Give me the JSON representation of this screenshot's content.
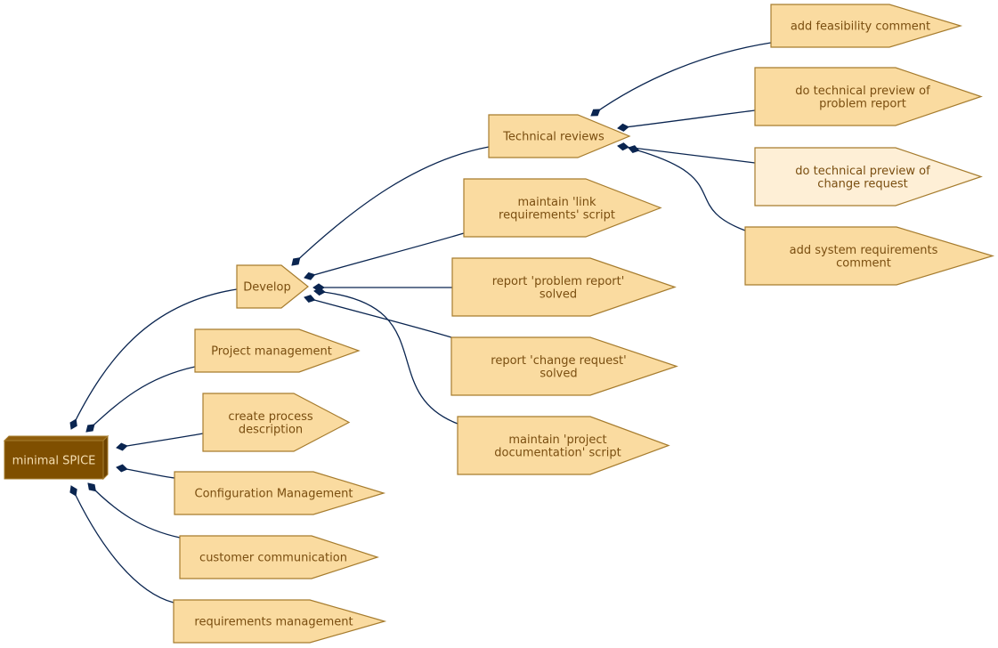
{
  "diagram": {
    "title": "minimal SPICE",
    "colors": {
      "edge": "#0a2550",
      "node_fill": "#fadba0",
      "node_fill_light": "#feefd6",
      "node_border": "#a67c2e",
      "node_text": "#7a4e10",
      "root_fill": "#7f4f00",
      "root_text": "#f5deb0"
    },
    "root": {
      "id": "root",
      "label": "minimal SPICE"
    },
    "nodes": [
      {
        "id": "develop",
        "lines": [
          "Develop"
        ],
        "parent": "root"
      },
      {
        "id": "project-management",
        "lines": [
          "Project management"
        ],
        "parent": "root"
      },
      {
        "id": "create-process-description",
        "lines": [
          "create process",
          "description"
        ],
        "parent": "root"
      },
      {
        "id": "configuration-management",
        "lines": [
          "Configuration Management"
        ],
        "parent": "root"
      },
      {
        "id": "customer-communication",
        "lines": [
          "customer communication"
        ],
        "parent": "root"
      },
      {
        "id": "requirements-management",
        "lines": [
          "requirements management"
        ],
        "parent": "root"
      },
      {
        "id": "technical-reviews",
        "lines": [
          "Technical reviews"
        ],
        "parent": "develop"
      },
      {
        "id": "maintain-link-requirements-script",
        "lines": [
          "maintain 'link",
          "requirements' script"
        ],
        "parent": "develop"
      },
      {
        "id": "report-problem-report-solved",
        "lines": [
          "report 'problem report'",
          "solved"
        ],
        "parent": "develop"
      },
      {
        "id": "report-change-request-solved",
        "lines": [
          "report 'change request'",
          "solved"
        ],
        "parent": "develop"
      },
      {
        "id": "maintain-project-documentation-script",
        "lines": [
          "maintain 'project",
          "documentation' script"
        ],
        "parent": "develop"
      },
      {
        "id": "add-feasibility-comment",
        "lines": [
          "add feasibility comment"
        ],
        "parent": "technical-reviews"
      },
      {
        "id": "do-technical-preview-of-problem-report",
        "lines": [
          "do technical preview of",
          "problem report"
        ],
        "parent": "technical-reviews"
      },
      {
        "id": "do-technical-preview-of-change-request",
        "lines": [
          "do technical preview of",
          "change request"
        ],
        "parent": "technical-reviews",
        "highlight": "light"
      },
      {
        "id": "add-system-requirements-comment",
        "lines": [
          "add system requirements",
          "comment"
        ],
        "parent": "technical-reviews"
      }
    ]
  }
}
